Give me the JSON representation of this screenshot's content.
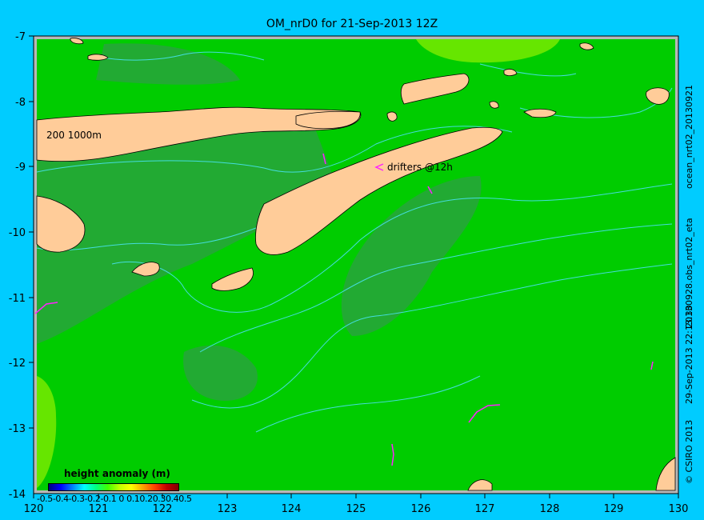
{
  "title": "OM_nrD0 for 21-Sep-2013 12Z",
  "map": {
    "lon_ticks": [
      "120",
      "121",
      "122",
      "123",
      "124",
      "125",
      "126",
      "127",
      "128",
      "129",
      "130"
    ],
    "lat_ticks": [
      "-7",
      "-8",
      "-9",
      "-10",
      "-11",
      "-12",
      "-13",
      "-14"
    ],
    "contour_label": "200  1000m",
    "drifter_label": "drifters @12h",
    "colors": {
      "land": "#ffcc99",
      "ocean_base": "#00cc00",
      "ocean_low": "#22aa33",
      "ocean_high": "#66e600",
      "contour": "#44dddd",
      "drifter": "#ff22ff"
    }
  },
  "legend": {
    "title": "height anomaly  (m)",
    "ticks": "-0.5-0.4-0.3-0.2-0.1 0 0.10.20.30.40.5",
    "colormap": [
      "#000080",
      "#0000ff",
      "#0080ff",
      "#00ffff",
      "#00ff80",
      "#40ff00",
      "#c0ff00",
      "#ffff00",
      "#ffa000",
      "#ff4000",
      "#c00000",
      "#800000"
    ]
  },
  "side_text": {
    "right_top": "ocean_nrt02_20130921",
    "right_mid": "20130928.obs_nrt02_eta",
    "right_bottom": "29-Sep-2013 22:13:30",
    "copyright": "© CSIRO 2013"
  }
}
